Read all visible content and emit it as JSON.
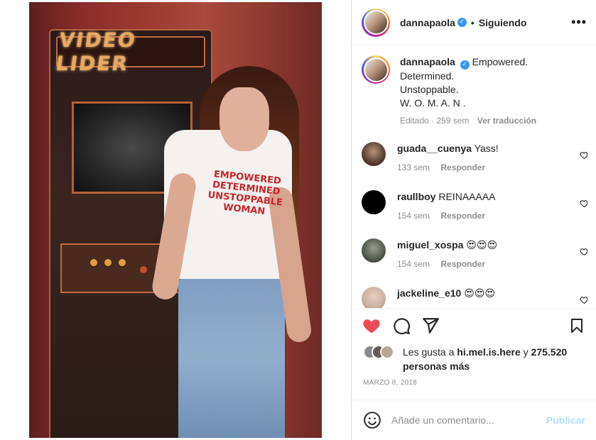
{
  "post": {
    "image_alt": "photo",
    "arcade_sign": "VIDEO LIDER",
    "shirt_text": "EMPOWERED DETERMINED UNSTOPPABLE WOMAN"
  },
  "header": {
    "username": "dannapaola",
    "verified": "✓",
    "separator": "•",
    "follow_status": "Siguiendo",
    "more": "•••"
  },
  "caption": {
    "username": "dannapaola",
    "verified": "✓",
    "text": "Empowered.\nDetermined.\nUnstoppable.\nW. O. M. A. N .",
    "edited": "Editado · 259 sem",
    "translate": "Ver traducción"
  },
  "comments": [
    {
      "username": "guada__cuenya",
      "text": "Yass!",
      "time": "133 sem",
      "reply": "Responder",
      "avatar_color": "#5a3d33"
    },
    {
      "username": "raullboy",
      "text": "REINAAAAA",
      "time": "154 sem",
      "reply": "Responder",
      "avatar_color": "#000000"
    },
    {
      "username": "miguel_xospa",
      "text": "😍😍😍",
      "time": "154 sem",
      "reply": "Responder",
      "avatar_color": "#4f5a4a"
    },
    {
      "username": "jackeline_e10",
      "text": "😍😍😍",
      "time": "",
      "reply": "",
      "avatar_color": "#c8b0a0"
    }
  ],
  "actions": {
    "like_color": "#ed4956",
    "icons": [
      "heart-filled-icon",
      "comment-icon",
      "share-icon",
      "bookmark-icon"
    ]
  },
  "likes": {
    "prefix": "Les gusta a",
    "user": "hi.mel.is.here",
    "conj": "y",
    "others": "275.520 personas más"
  },
  "date": "MARZO 8, 2018",
  "comment_box": {
    "placeholder": "Añade un comentario...",
    "publish": "Publicar",
    "publish_color": "#b2dffc"
  }
}
